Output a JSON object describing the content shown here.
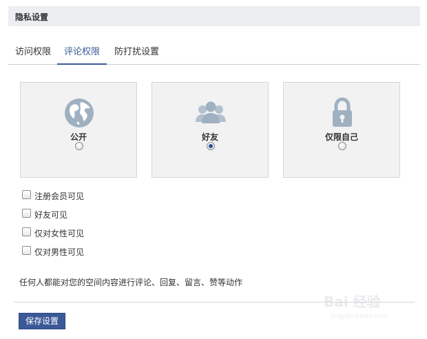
{
  "header": {
    "title": "隐私设置"
  },
  "tabs": [
    {
      "label": "访问权限",
      "active": false
    },
    {
      "label": "评论权限",
      "active": true
    },
    {
      "label": "防打扰设置",
      "active": false
    }
  ],
  "options": [
    {
      "label": "公开",
      "icon": "globe-icon",
      "selected": false
    },
    {
      "label": "好友",
      "icon": "people-icon",
      "selected": true
    },
    {
      "label": "仅限自己",
      "icon": "lock-icon",
      "selected": false
    }
  ],
  "checkboxes": [
    {
      "label": "注册会员可见",
      "checked": false
    },
    {
      "label": "好友可见",
      "checked": false
    },
    {
      "label": "仅对女性可见",
      "checked": false
    },
    {
      "label": "仅对男性可见",
      "checked": false
    }
  ],
  "description": "任何人都能对您的空间内容进行评论、回复、留言、赞等动作",
  "save_button": {
    "label": "保存设置"
  },
  "watermark": {
    "text": "Bai 经验",
    "url": "jingyan.baidu.com"
  },
  "colors": {
    "accent": "#3b5998",
    "header_bg": "#eceef1",
    "card_bg": "#f2f2f2",
    "icon_color": "#9fb0c1"
  }
}
